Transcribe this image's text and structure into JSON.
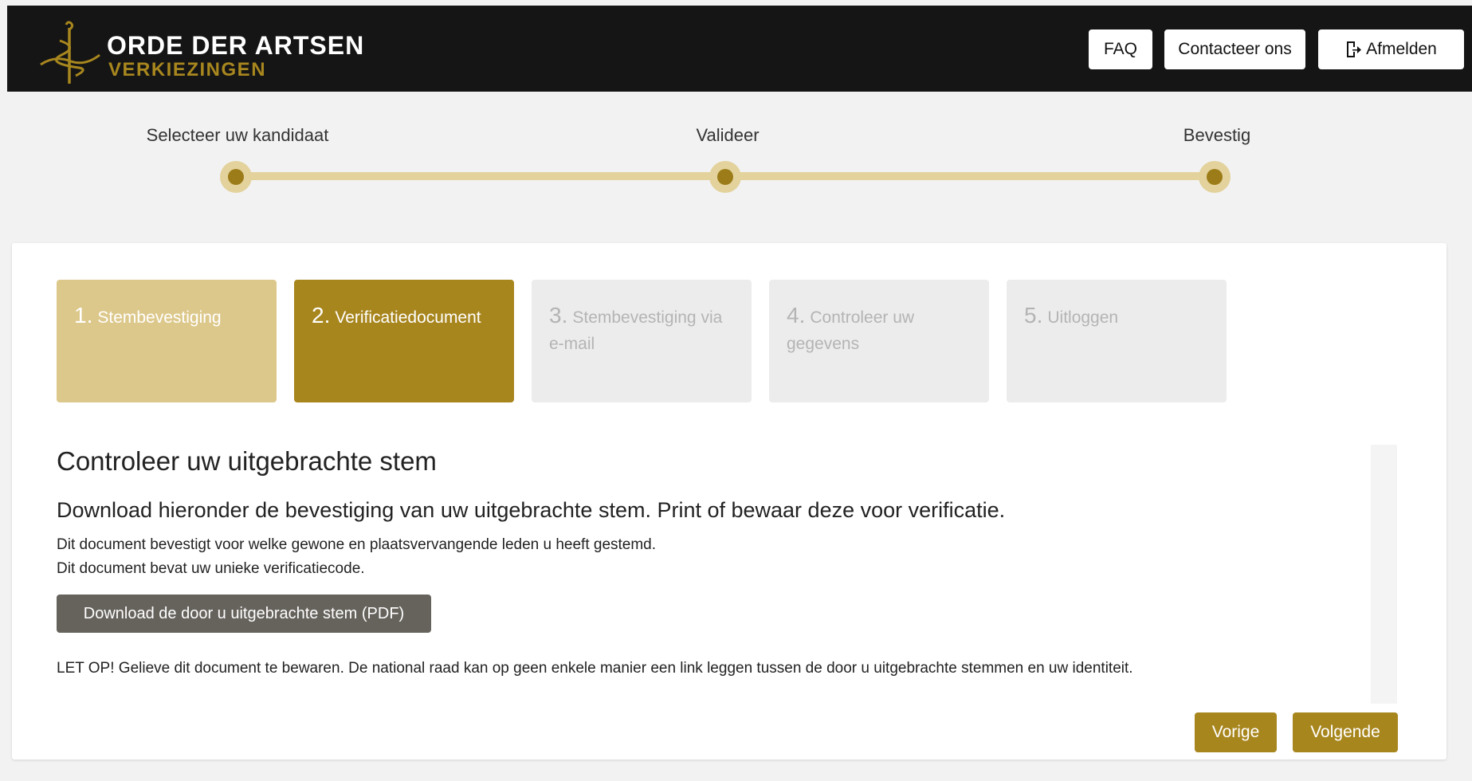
{
  "header": {
    "brand_name": "ORDE DER ARTSEN",
    "brand_sub": "VERKIEZINGEN",
    "buttons": {
      "faq": "FAQ",
      "contact": "Contacteer ons",
      "logout": "Afmelden"
    },
    "icons": [
      "caduceus-logo-icon",
      "logout-icon"
    ]
  },
  "tracker": {
    "steps": [
      "Selecteer uw kandidaat",
      "Valideer",
      "Bevestig"
    ]
  },
  "wizard": {
    "steps": [
      {
        "num": "1.",
        "label": "Stembevestiging",
        "state": "done"
      },
      {
        "num": "2.",
        "label": "Verificatiedocument",
        "state": "active"
      },
      {
        "num": "3.",
        "label": "Stembevestiging via e-mail",
        "state": "todo"
      },
      {
        "num": "4.",
        "label": "Controleer uw gegevens",
        "state": "todo"
      },
      {
        "num": "5.",
        "label": "Uitloggen",
        "state": "todo"
      }
    ]
  },
  "content": {
    "title": "Controleer uw uitgebrachte stem",
    "subtitle": "Download hieronder de bevestiging van uw uitgebrachte stem. Print of bewaar deze voor verificatie.",
    "line1": "Dit document bevestigt voor welke gewone en plaatsvervangende leden u heeft gestemd.",
    "line2": "Dit document bevat uw unieke verificatiecode.",
    "download_label": "Download de door u uitgebrachte stem (PDF)",
    "warning": "LET OP! Gelieve dit document te bewaren. De national raad kan op geen enkele manier een link leggen tussen de door u uitgebrachte stemmen en uw identiteit."
  },
  "nav": {
    "prev": "Vorige",
    "next": "Volgende"
  },
  "colors": {
    "header_bg": "#151515",
    "gold": "#a8861e",
    "gold_light": "#ddc88b",
    "track": "#e3d29c",
    "tile_inactive": "#ececec",
    "download_bg": "#66635d"
  }
}
